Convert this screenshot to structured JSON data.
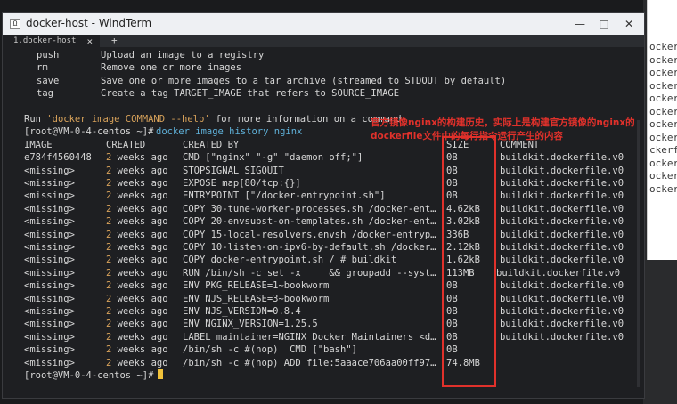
{
  "background_terminal": {
    "lines": [
      "ockerfi",
      "ockerfi",
      "ockerfi",
      "ockerfi",
      "ockerfi",
      "ockerfi",
      "ockerfi",
      "ockerfi",
      "ckerfil",
      "ockerfi",
      "ockerfi",
      "ockerfi"
    ]
  },
  "window": {
    "title": "docker-host - WindTerm",
    "icon_glyph": "Ω",
    "controls": {
      "minimize": "—",
      "maximize": "□",
      "close": "✕"
    }
  },
  "tab": {
    "label": "1.docker-host",
    "close": "×",
    "add": "+"
  },
  "help_lines": [
    {
      "cmd": "push",
      "desc": "Upload an image to a registry"
    },
    {
      "cmd": "rm",
      "desc": "Remove one or more images"
    },
    {
      "cmd": "save",
      "desc": "Save one or more images to a tar archive (streamed to STDOUT by default)"
    },
    {
      "cmd": "tag",
      "desc": "Create a tag TARGET_IMAGE that refers to SOURCE_IMAGE"
    }
  ],
  "run_hint": {
    "prefix": "Run ",
    "cmd": "'docker image COMMAND --help'",
    "suffix": " for more information on a command."
  },
  "prompt": "[root@VM-0-4-centos ~]#",
  "command": "docker image history nginx",
  "table": {
    "headers": [
      "IMAGE",
      "CREATED",
      "CREATED BY",
      "SIZE",
      "COMMENT"
    ],
    "rows": [
      [
        "e784f4560448",
        "2 weeks ago",
        "CMD [\"nginx\" \"-g\" \"daemon off;\"]",
        "0B",
        "buildkit.dockerfile.v0"
      ],
      [
        "<missing>",
        "2 weeks ago",
        "STOPSIGNAL SIGQUIT",
        "0B",
        "buildkit.dockerfile.v0"
      ],
      [
        "<missing>",
        "2 weeks ago",
        "EXPOSE map[80/tcp:{}]",
        "0B",
        "buildkit.dockerfile.v0"
      ],
      [
        "<missing>",
        "2 weeks ago",
        "ENTRYPOINT [\"/docker-entrypoint.sh\"]",
        "0B",
        "buildkit.dockerfile.v0"
      ],
      [
        "<missing>",
        "2 weeks ago",
        "COPY 30-tune-worker-processes.sh /docker-ent…",
        "4.62kB",
        "buildkit.dockerfile.v0"
      ],
      [
        "<missing>",
        "2 weeks ago",
        "COPY 20-envsubst-on-templates.sh /docker-ent…",
        "3.02kB",
        "buildkit.dockerfile.v0"
      ],
      [
        "<missing>",
        "2 weeks ago",
        "COPY 15-local-resolvers.envsh /docker-entryp…",
        "336B",
        "buildkit.dockerfile.v0"
      ],
      [
        "<missing>",
        "2 weeks ago",
        "COPY 10-listen-on-ipv6-by-default.sh /docker…",
        "2.12kB",
        "buildkit.dockerfile.v0"
      ],
      [
        "<missing>",
        "2 weeks ago",
        "COPY docker-entrypoint.sh / # buildkit",
        "1.62kB",
        "buildkit.dockerfile.v0"
      ],
      [
        "<missing>",
        "2 weeks ago",
        "RUN /bin/sh -c set -x     && groupadd --syst…",
        "113MB",
        "buildkit.dockerfile.v0"
      ],
      [
        "<missing>",
        "2 weeks ago",
        "ENV PKG_RELEASE=1~bookworm",
        "0B",
        "buildkit.dockerfile.v0"
      ],
      [
        "<missing>",
        "2 weeks ago",
        "ENV NJS_RELEASE=3~bookworm",
        "0B",
        "buildkit.dockerfile.v0"
      ],
      [
        "<missing>",
        "2 weeks ago",
        "ENV NJS_VERSION=0.8.4",
        "0B",
        "buildkit.dockerfile.v0"
      ],
      [
        "<missing>",
        "2 weeks ago",
        "ENV NGINX_VERSION=1.25.5",
        "0B",
        "buildkit.dockerfile.v0"
      ],
      [
        "<missing>",
        "2 weeks ago",
        "LABEL maintainer=NGINX Docker Maintainers <d…",
        "0B",
        "buildkit.dockerfile.v0"
      ],
      [
        "<missing>",
        "2 weeks ago",
        "/bin/sh -c #(nop)  CMD [\"bash\"]",
        "0B",
        ""
      ],
      [
        "<missing>",
        "2 weeks ago",
        "/bin/sh -c #(nop) ADD file:5aaace706aa00ff97…",
        "74.8MB",
        ""
      ]
    ]
  },
  "final_prompt": "[root@VM-0-4-centos ~]#",
  "annotation": "官方镜像nginx的构建历史，实际上是构建官方镜像的nginx的dockerfile文件中的每行指令运行产生的内容",
  "colors": {
    "highlight": "#e0312b",
    "prompt_cmd": "#5fb0d8",
    "string": "#d9a35b"
  }
}
